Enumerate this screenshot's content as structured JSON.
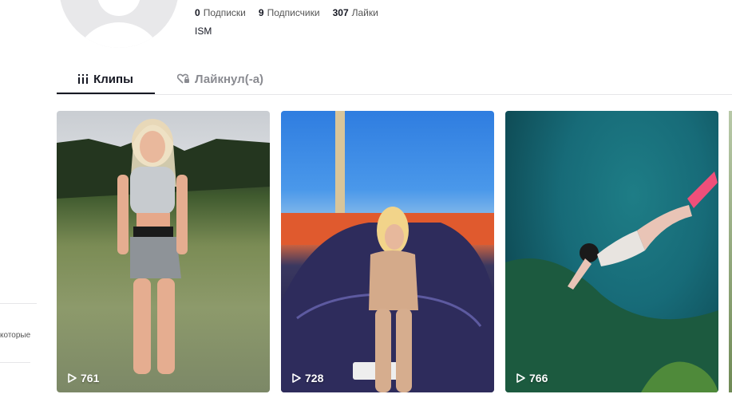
{
  "profile": {
    "stats": [
      {
        "count": "0",
        "label": "Подписки"
      },
      {
        "count": "9",
        "label": "Подписчики"
      },
      {
        "count": "307",
        "label": "Лайки"
      }
    ],
    "bio": "ISM"
  },
  "tabs": [
    {
      "label": "Клипы",
      "icon": "grid-icon",
      "active": true
    },
    {
      "label": "Лайкнул(-а)",
      "icon": "heart-lock-icon",
      "active": false
    }
  ],
  "sidebar": {
    "partial_text": "которые"
  },
  "videos": [
    {
      "views": "761",
      "icon": "play-icon"
    },
    {
      "views": "728",
      "icon": "play-icon"
    },
    {
      "views": "766",
      "icon": "play-icon"
    }
  ]
}
